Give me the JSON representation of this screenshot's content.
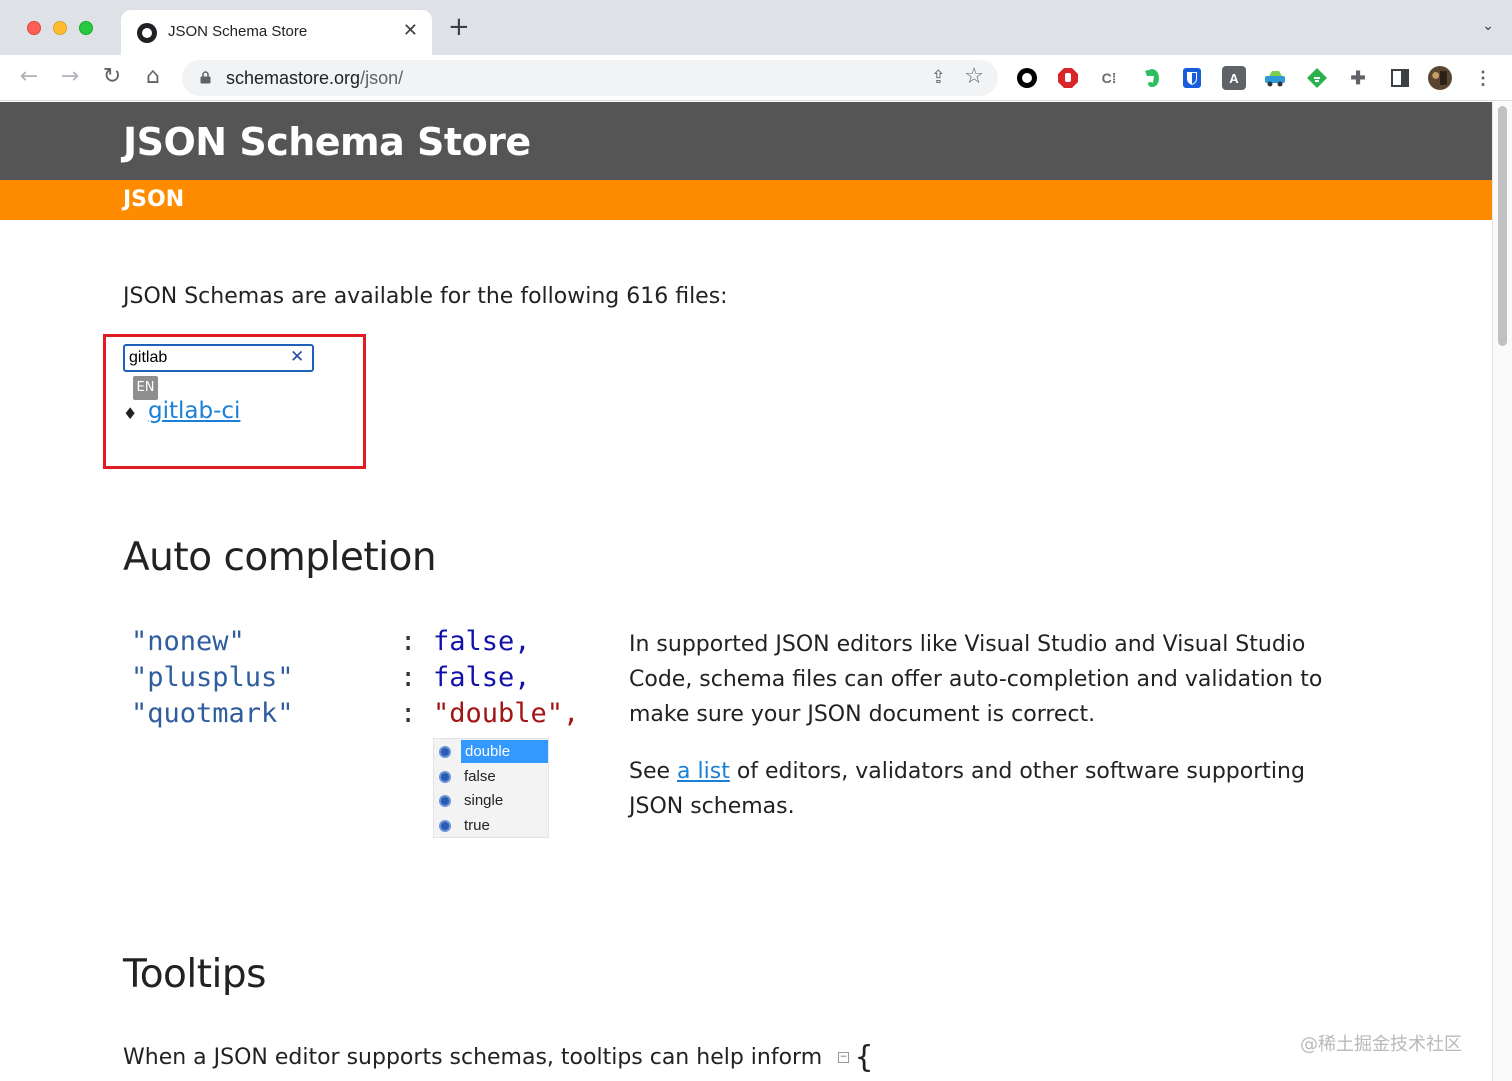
{
  "browser": {
    "tab_title": "JSON Schema Store",
    "url_host": "schemastore.org",
    "url_path": "/json/",
    "close_glyph": "✕",
    "new_tab_glyph": "+",
    "tab_menu_glyph": "⌄"
  },
  "site": {
    "title": "JSON Schema Store",
    "nav_label": "JSON"
  },
  "intro_text": "JSON Schemas are available for the following 616 files:",
  "search": {
    "value": "gitlab",
    "clear_glyph": "✕",
    "lang_badge": "EN",
    "results": [
      {
        "label": "gitlab-ci"
      }
    ]
  },
  "auto_completion": {
    "heading": "Auto completion",
    "code_lines": [
      {
        "key": "\"nonew\"",
        "colon": ":",
        "value": "false,",
        "kind": "bool"
      },
      {
        "key": "\"plusplus\"",
        "colon": ":",
        "value": "false,",
        "kind": "bool"
      },
      {
        "key": "\"quotmark\"",
        "colon": ":",
        "value": "\"double\",",
        "kind": "string"
      }
    ],
    "suggestions": [
      {
        "label": "double",
        "selected": true
      },
      {
        "label": "false",
        "selected": false
      },
      {
        "label": "single",
        "selected": false
      },
      {
        "label": "true",
        "selected": false
      }
    ],
    "description": "In supported JSON editors like Visual Studio and Visual Studio Code, schema files can offer auto-completion and validation to make sure your JSON document is correct.",
    "see_prefix": "See ",
    "see_link": "a list",
    "see_suffix": " of editors, validators and other software supporting JSON schemas."
  },
  "tooltips": {
    "heading": "Tooltips",
    "text": "When a JSON editor supports schemas, tooltips can help inform",
    "code_brace": "{",
    "collapse_glyph": "−"
  },
  "watermark": "@稀土掘金技术社区"
}
